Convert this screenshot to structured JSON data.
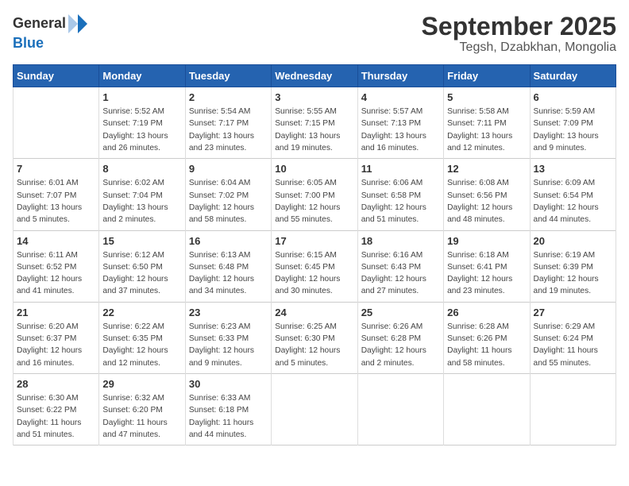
{
  "logo": {
    "general": "General",
    "blue": "Blue"
  },
  "title": {
    "month": "September 2025",
    "location": "Tegsh, Dzabkhan, Mongolia"
  },
  "weekdays": [
    "Sunday",
    "Monday",
    "Tuesday",
    "Wednesday",
    "Thursday",
    "Friday",
    "Saturday"
  ],
  "weeks": [
    [
      {
        "day": "",
        "info": ""
      },
      {
        "day": "1",
        "info": "Sunrise: 5:52 AM\nSunset: 7:19 PM\nDaylight: 13 hours\nand 26 minutes."
      },
      {
        "day": "2",
        "info": "Sunrise: 5:54 AM\nSunset: 7:17 PM\nDaylight: 13 hours\nand 23 minutes."
      },
      {
        "day": "3",
        "info": "Sunrise: 5:55 AM\nSunset: 7:15 PM\nDaylight: 13 hours\nand 19 minutes."
      },
      {
        "day": "4",
        "info": "Sunrise: 5:57 AM\nSunset: 7:13 PM\nDaylight: 13 hours\nand 16 minutes."
      },
      {
        "day": "5",
        "info": "Sunrise: 5:58 AM\nSunset: 7:11 PM\nDaylight: 13 hours\nand 12 minutes."
      },
      {
        "day": "6",
        "info": "Sunrise: 5:59 AM\nSunset: 7:09 PM\nDaylight: 13 hours\nand 9 minutes."
      }
    ],
    [
      {
        "day": "7",
        "info": "Sunrise: 6:01 AM\nSunset: 7:07 PM\nDaylight: 13 hours\nand 5 minutes."
      },
      {
        "day": "8",
        "info": "Sunrise: 6:02 AM\nSunset: 7:04 PM\nDaylight: 13 hours\nand 2 minutes."
      },
      {
        "day": "9",
        "info": "Sunrise: 6:04 AM\nSunset: 7:02 PM\nDaylight: 12 hours\nand 58 minutes."
      },
      {
        "day": "10",
        "info": "Sunrise: 6:05 AM\nSunset: 7:00 PM\nDaylight: 12 hours\nand 55 minutes."
      },
      {
        "day": "11",
        "info": "Sunrise: 6:06 AM\nSunset: 6:58 PM\nDaylight: 12 hours\nand 51 minutes."
      },
      {
        "day": "12",
        "info": "Sunrise: 6:08 AM\nSunset: 6:56 PM\nDaylight: 12 hours\nand 48 minutes."
      },
      {
        "day": "13",
        "info": "Sunrise: 6:09 AM\nSunset: 6:54 PM\nDaylight: 12 hours\nand 44 minutes."
      }
    ],
    [
      {
        "day": "14",
        "info": "Sunrise: 6:11 AM\nSunset: 6:52 PM\nDaylight: 12 hours\nand 41 minutes."
      },
      {
        "day": "15",
        "info": "Sunrise: 6:12 AM\nSunset: 6:50 PM\nDaylight: 12 hours\nand 37 minutes."
      },
      {
        "day": "16",
        "info": "Sunrise: 6:13 AM\nSunset: 6:48 PM\nDaylight: 12 hours\nand 34 minutes."
      },
      {
        "day": "17",
        "info": "Sunrise: 6:15 AM\nSunset: 6:45 PM\nDaylight: 12 hours\nand 30 minutes."
      },
      {
        "day": "18",
        "info": "Sunrise: 6:16 AM\nSunset: 6:43 PM\nDaylight: 12 hours\nand 27 minutes."
      },
      {
        "day": "19",
        "info": "Sunrise: 6:18 AM\nSunset: 6:41 PM\nDaylight: 12 hours\nand 23 minutes."
      },
      {
        "day": "20",
        "info": "Sunrise: 6:19 AM\nSunset: 6:39 PM\nDaylight: 12 hours\nand 19 minutes."
      }
    ],
    [
      {
        "day": "21",
        "info": "Sunrise: 6:20 AM\nSunset: 6:37 PM\nDaylight: 12 hours\nand 16 minutes."
      },
      {
        "day": "22",
        "info": "Sunrise: 6:22 AM\nSunset: 6:35 PM\nDaylight: 12 hours\nand 12 minutes."
      },
      {
        "day": "23",
        "info": "Sunrise: 6:23 AM\nSunset: 6:33 PM\nDaylight: 12 hours\nand 9 minutes."
      },
      {
        "day": "24",
        "info": "Sunrise: 6:25 AM\nSunset: 6:30 PM\nDaylight: 12 hours\nand 5 minutes."
      },
      {
        "day": "25",
        "info": "Sunrise: 6:26 AM\nSunset: 6:28 PM\nDaylight: 12 hours\nand 2 minutes."
      },
      {
        "day": "26",
        "info": "Sunrise: 6:28 AM\nSunset: 6:26 PM\nDaylight: 11 hours\nand 58 minutes."
      },
      {
        "day": "27",
        "info": "Sunrise: 6:29 AM\nSunset: 6:24 PM\nDaylight: 11 hours\nand 55 minutes."
      }
    ],
    [
      {
        "day": "28",
        "info": "Sunrise: 6:30 AM\nSunset: 6:22 PM\nDaylight: 11 hours\nand 51 minutes."
      },
      {
        "day": "29",
        "info": "Sunrise: 6:32 AM\nSunset: 6:20 PM\nDaylight: 11 hours\nand 47 minutes."
      },
      {
        "day": "30",
        "info": "Sunrise: 6:33 AM\nSunset: 6:18 PM\nDaylight: 11 hours\nand 44 minutes."
      },
      {
        "day": "",
        "info": ""
      },
      {
        "day": "",
        "info": ""
      },
      {
        "day": "",
        "info": ""
      },
      {
        "day": "",
        "info": ""
      }
    ]
  ]
}
